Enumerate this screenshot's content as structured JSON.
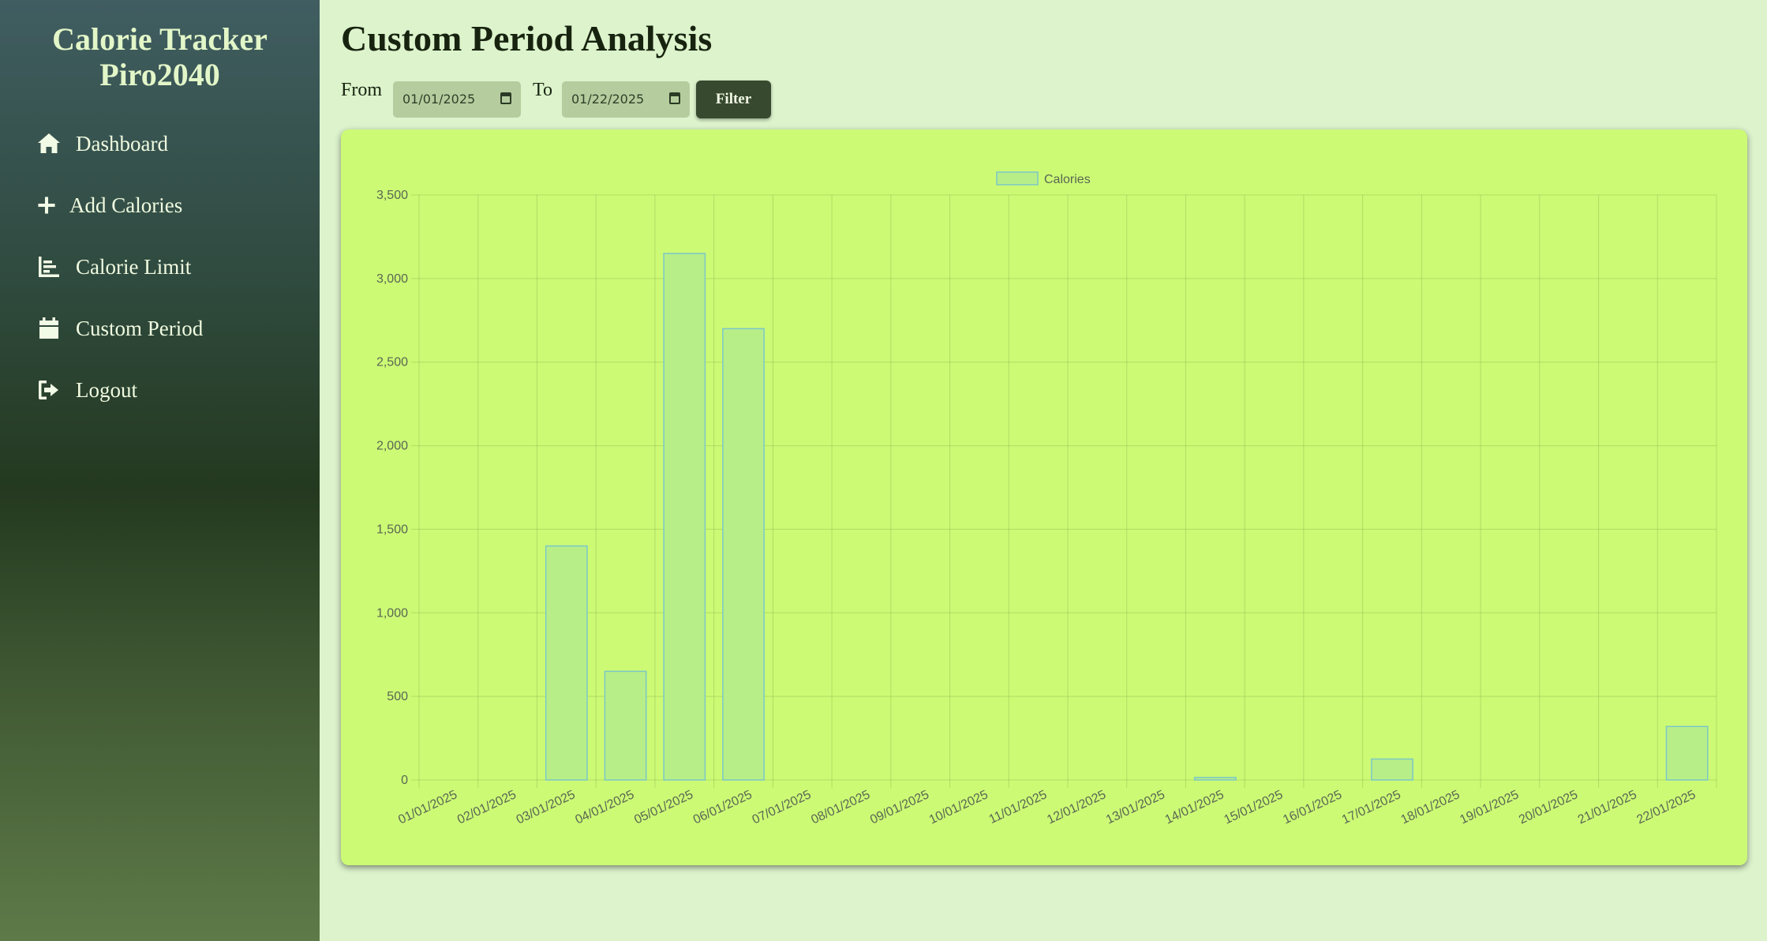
{
  "app": {
    "title_line1": "Calorie Tracker",
    "title_line2": "Piro2040"
  },
  "sidebar": {
    "items": [
      {
        "label": "Dashboard",
        "icon": "home-icon"
      },
      {
        "label": "Add Calories",
        "icon": "plus-icon"
      },
      {
        "label": "Calorie Limit",
        "icon": "chart-icon"
      },
      {
        "label": "Custom Period",
        "icon": "calendar-icon"
      },
      {
        "label": "Logout",
        "icon": "logout-icon"
      }
    ]
  },
  "main": {
    "title": "Custom Period Analysis",
    "filter": {
      "from_label": "From",
      "from_value": "01/01/2025",
      "to_label": "To",
      "to_value": "01/22/2025",
      "button_label": "Filter"
    }
  },
  "colors": {
    "background": "#dcf3cc",
    "card": "#ccfa75",
    "bar_fill": "#b8ee88",
    "bar_border": "#7cc7c7",
    "button": "#374a2f"
  },
  "chart_data": {
    "type": "bar",
    "legend": {
      "label": "Calories",
      "position": "top-center"
    },
    "categories": [
      "01/01/2025",
      "02/01/2025",
      "03/01/2025",
      "04/01/2025",
      "05/01/2025",
      "06/01/2025",
      "07/01/2025",
      "08/01/2025",
      "09/01/2025",
      "10/01/2025",
      "11/01/2025",
      "12/01/2025",
      "13/01/2025",
      "14/01/2025",
      "15/01/2025",
      "16/01/2025",
      "17/01/2025",
      "18/01/2025",
      "19/01/2025",
      "20/01/2025",
      "21/01/2025",
      "22/01/2025"
    ],
    "series": [
      {
        "name": "Calories",
        "values": [
          0,
          0,
          1400,
          650,
          3150,
          2700,
          0,
          0,
          0,
          0,
          0,
          0,
          0,
          15,
          0,
          0,
          125,
          0,
          0,
          0,
          0,
          320
        ]
      }
    ],
    "ylim": [
      0,
      3500
    ],
    "yticks": [
      0,
      500,
      1000,
      1500,
      2000,
      2500,
      3000,
      3500
    ],
    "ytick_labels": [
      "0",
      "500",
      "1,000",
      "1,500",
      "2,000",
      "2,500",
      "3,000",
      "3,500"
    ],
    "grid": true
  }
}
